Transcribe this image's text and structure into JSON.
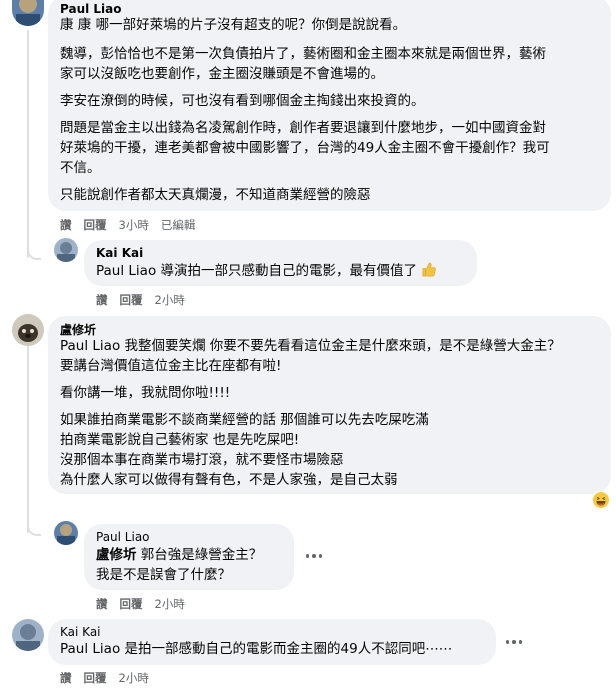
{
  "comments": [
    {
      "author": "Paul Liao",
      "lines": [
        "康 康 哪一部好萊塢的片子沒有超支的呢？你倒是說說看。",
        "魏導，彭恰恰也不是第一次負債拍片了，藝術圈和金主圈本來就是兩個世界，藝術",
        "家可以沒飯吃也要創作，金主圈沒賺頭是不會進場的。",
        "李安在潦倒的時候，可也沒有看到哪個金主掏錢出來投資的。",
        "問題是當金主以出錢為名凌駕創作時，創作者要退讓到什麼地步，一如中國資金對",
        "好萊塢的干擾，連老美都會被中國影響了，台灣的49人金主圈不會干擾創作？我可",
        "不信。",
        "只能說創作者都太天真爛漫，不知道商業經營的險惡"
      ],
      "actions": {
        "like": "讚",
        "reply": "回覆",
        "time": "3小時",
        "edited": "已編輯"
      }
    },
    {
      "author": "Kai Kai",
      "mention": "Paul Liao",
      "line": " 導演拍一部只感動自己的電影，最有價值了",
      "emoji": "thumbs-up",
      "actions": {
        "like": "讚",
        "reply": "回覆",
        "time": "2小時"
      }
    },
    {
      "author": "盧修圻",
      "first_mention": "Paul Liao",
      "lines": [
        " 我整個要笑爛 你要不要先看看這位金主是什麼來頭，是不是綠營大金主？",
        "要講台灣價值這位金主比在座都有啦!",
        "看你講一堆，我就問你啦!!!!",
        "如果誰拍商業電影不談商業經營的話 那個誰可以先去吃屎吃滿",
        "拍商業電影說自己藝術家 也是先吃屎吧!",
        "沒那個本事在商業市場打滾，就不要怪市場險惡",
        "為什麼人家可以做得有聲有色，不是人家強，是自己太弱"
      ],
      "reaction": "haha",
      "actions": {
        "like": "讚",
        "reply": "回覆",
        "time": "3小時"
      }
    },
    {
      "author": "Paul Liao",
      "mention": "盧修圻",
      "line1": " 郭台強是綠營金主？",
      "line2": "我是不是誤會了什麼？",
      "actions": {
        "like": "讚",
        "reply": "回覆",
        "time": "2小時"
      }
    },
    {
      "author": "Kai Kai",
      "mention": "Paul Liao",
      "line": " 是拍一部感動自己的電影而金主圈的49人不認同吧⋯⋯",
      "actions": {
        "like": "讚",
        "reply": "回覆",
        "time": "2小時"
      }
    }
  ],
  "colors": {
    "bubble": "#f0f2f5",
    "meta": "#65676b",
    "text": "#050505"
  }
}
